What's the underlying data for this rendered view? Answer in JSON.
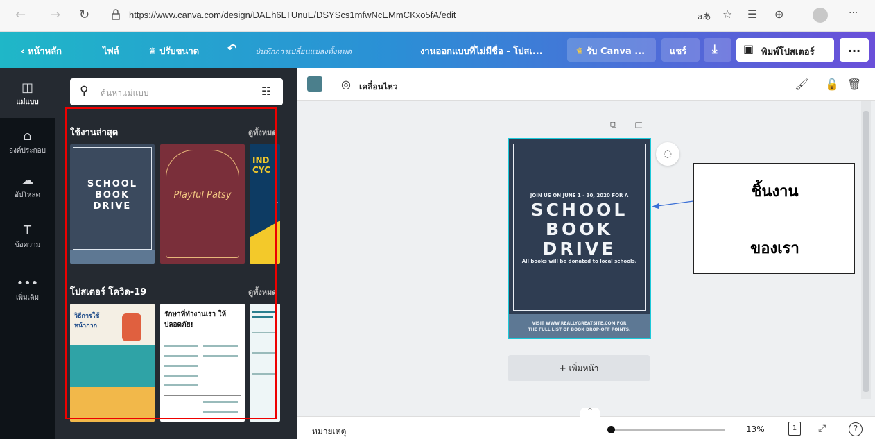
{
  "browser": {
    "url": "https://www.canva.com/design/DAEh6LTUnuE/DSYScs1mfwNcEMmCKxo5fA/edit",
    "extension_label": "a’́"
  },
  "topbar": {
    "home": "หน้าหลัก",
    "file": "ไฟล์",
    "resize": "ปรับขนาด",
    "autosave": "บันทึกการเปลี่ยนแปลงทั้งหมด",
    "design_title": "งานออกแบบที่ไม่มีชื่อ - โปสเ...",
    "get_canva": "รับ Canva ...",
    "share": "แชร์",
    "print": "พิมพ์โปสเตอร์",
    "more": "..."
  },
  "rail": {
    "items": [
      {
        "label": "แม่แบบ",
        "icon": "template-icon"
      },
      {
        "label": "องค์ประกอบ",
        "icon": "elements-icon"
      },
      {
        "label": "อัปโหลด",
        "icon": "upload-icon"
      },
      {
        "label": "ข้อความ",
        "icon": "text-icon"
      },
      {
        "label": "เพิ่มเติม",
        "icon": "more-icon"
      }
    ]
  },
  "panel": {
    "search_placeholder": "ค้นหาแม่แบบ",
    "recent_title": "ใช้งานล่าสุด",
    "see_all_1": "ดูทั้งหมด",
    "covid_title": "โปสเตอร์ โควิด-19",
    "see_all_2": "ดูทั้งหมด",
    "thumb_school": [
      "SCHOOL",
      "BOOK",
      "DRIVE"
    ],
    "thumb_playful": "Playful Patsy",
    "thumb_ind": "IND CYC",
    "covid_thumb_1": "วิธีการใช้ หน้ากาก",
    "covid_thumb_2": "รักษาที่ทำงานเรา ให้ปลอดภัย!"
  },
  "editor": {
    "animate": "เคลื่อนไหว",
    "poster": {
      "top_line": "JOIN US ON JUNE 1 - 30, 2020 FOR A",
      "line1": "SCHOOL",
      "line2": "BOOK",
      "line3": "DRIVE",
      "sub": "All books will be donated to local schools.",
      "footer1": "VISIT WWW.REALLYGREATSITE.COM FOR",
      "footer2": "THE FULL LIST OF BOOK DROP-OFF POINTS."
    },
    "add_page": "+ เพิ่มหน้า",
    "notes": "หมายเหตุ",
    "zoom": "13%",
    "page_count": "1"
  },
  "callout": {
    "line1": "ชิ้นงาน",
    "line2": "ของเรา"
  },
  "colors": {
    "accent": "#1bc9da",
    "highlight_box": "#ee0000",
    "panel_bg": "#252a31"
  }
}
